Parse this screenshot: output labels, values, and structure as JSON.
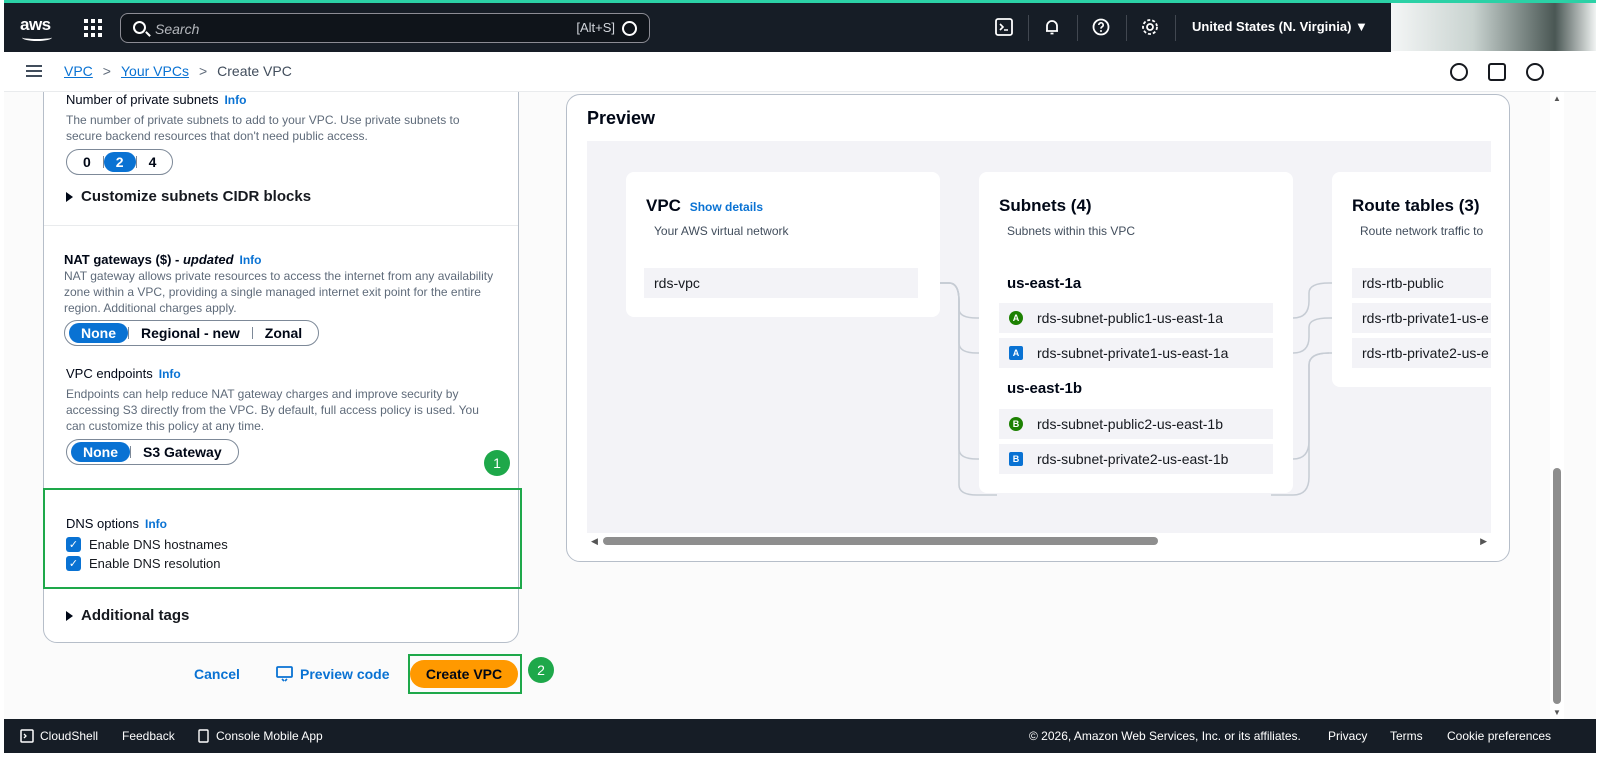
{
  "topbar": {
    "logo": "aws",
    "search_placeholder": "Search",
    "search_shortcut": "[Alt+S]",
    "region": "United States (N. Virginia) ▼"
  },
  "breadcrumb": {
    "items": [
      "VPC",
      "Your VPCs"
    ],
    "current": "Create VPC"
  },
  "form": {
    "private_subnets": {
      "label": "Number of private subnets",
      "info": "Info",
      "description_1": "The number of private subnets to add to your VPC. Use private subnets to",
      "description_2": "secure backend resources that don't need public access.",
      "options": [
        "0",
        "2",
        "4"
      ],
      "selected": "2"
    },
    "customize_cidr": "Customize subnets CIDR blocks",
    "nat": {
      "label_main": "NAT gateways ($) - ",
      "label_em": "updated",
      "info": "Info",
      "description_1": "NAT gateway allows private resources to access the internet from any availability",
      "description_2": "zone within a VPC, providing a single managed internet exit point for the entire",
      "description_3": "region. Additional charges apply.",
      "options": [
        "None",
        "Regional - new",
        "Zonal"
      ],
      "selected": "None"
    },
    "endpoints": {
      "label": "VPC endpoints",
      "info": "Info",
      "description_1": "Endpoints can help reduce NAT gateway charges and improve security by",
      "description_2": "accessing S3 directly from the VPC. By default, full access policy is used. You",
      "description_3": "can customize this policy at any time.",
      "options": [
        "None",
        "S3 Gateway"
      ],
      "selected": "None"
    },
    "dns": {
      "label": "DNS options",
      "info": "Info",
      "hostnames": "Enable DNS hostnames",
      "resolution": "Enable DNS resolution"
    },
    "additional_tags": "Additional tags"
  },
  "annotations": {
    "badge1": "1",
    "badge2": "2",
    "accent": "#1ea84a"
  },
  "actions": {
    "cancel": "Cancel",
    "preview_code": "Preview code",
    "create": "Create VPC"
  },
  "preview": {
    "title": "Preview",
    "vpc": {
      "title": "VPC",
      "show_details": "Show details",
      "sub": "Your AWS virtual network",
      "name": "rds-vpc"
    },
    "subnets": {
      "title": "Subnets (4)",
      "sub": "Subnets within this VPC",
      "az1": "us-east-1a",
      "az2": "us-east-1b",
      "items": [
        {
          "chip": "A",
          "kind": "public",
          "name": "rds-subnet-public1-us-east-1a"
        },
        {
          "chip": "A",
          "kind": "private",
          "name": "rds-subnet-private1-us-east-1a"
        },
        {
          "chip": "B",
          "kind": "public",
          "name": "rds-subnet-public2-us-east-1b"
        },
        {
          "chip": "B",
          "kind": "private",
          "name": "rds-subnet-private2-us-east-1b"
        }
      ]
    },
    "routes": {
      "title": "Route tables (3)",
      "sub": "Route network traffic to",
      "items": [
        "rds-rtb-public",
        "rds-rtb-private1-us-e",
        "rds-rtb-private2-us-e"
      ]
    }
  },
  "footer": {
    "cloudshell": "CloudShell",
    "feedback": "Feedback",
    "mobile_app": "Console Mobile App",
    "copyright": "© 2026, Amazon Web Services, Inc. or its affiliates.",
    "privacy": "Privacy",
    "terms": "Terms",
    "cookies": "Cookie preferences"
  }
}
